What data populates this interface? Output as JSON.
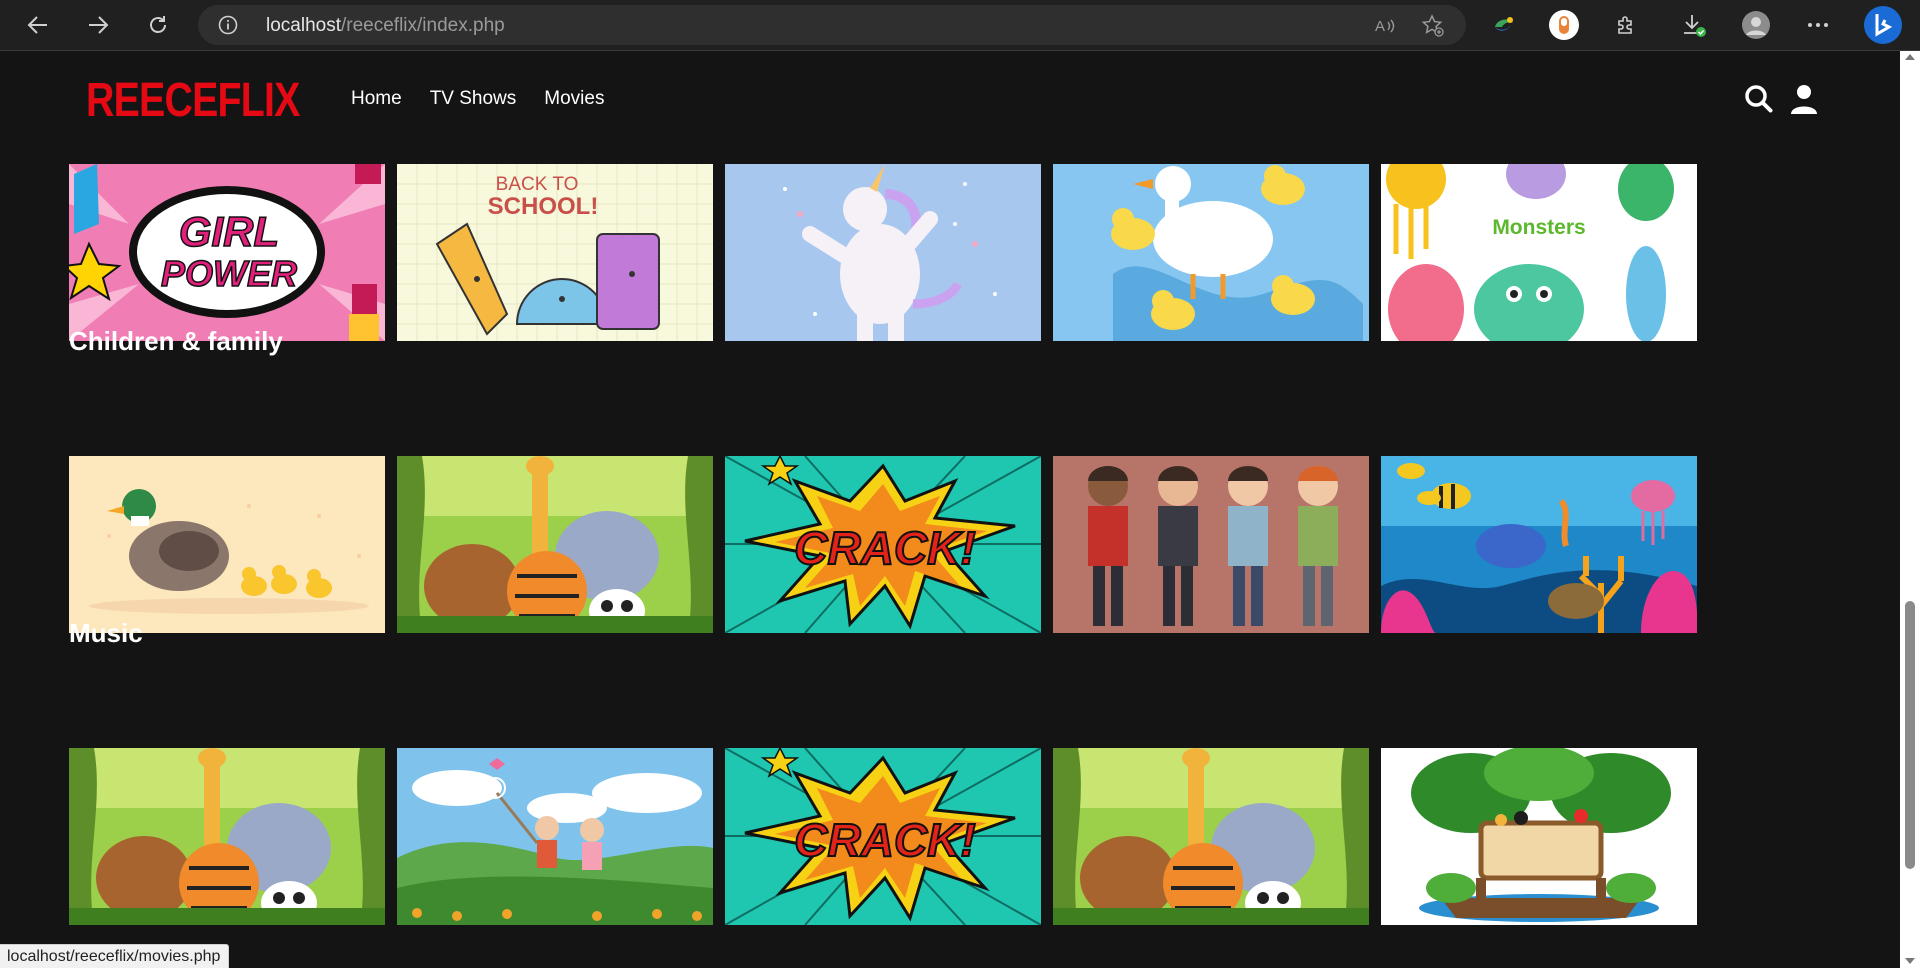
{
  "browser": {
    "url_host": "localhost",
    "url_path": "/reeceflix/index.php",
    "status_url": "localhost/reeceflix/movies.php"
  },
  "site": {
    "logo": "REECEFLIX",
    "nav": [
      "Home",
      "TV Shows",
      "Movies"
    ],
    "accent_color": "#e50914",
    "background_color": "#141414"
  },
  "rows": [
    {
      "title": "",
      "tiles": [
        "girl-power-comic",
        "back-to-school",
        "dabbing-unicorn",
        "goose-and-ducklings",
        "monsters"
      ]
    },
    {
      "title": "Children & family",
      "tiles": [
        "duck-family",
        "jungle-animals",
        "crack-comic",
        "boys-with-phones",
        "underwater-reef"
      ]
    },
    {
      "title": "Music",
      "tiles": [
        "jungle-animals",
        "kids-in-meadow",
        "crack-comic",
        "jungle-animals",
        "jungle-island-sign"
      ]
    }
  ],
  "artwork_text": {
    "girl_power_1": "GIRL",
    "girl_power_2": "POWER",
    "back_to_school_1": "BACK TO",
    "back_to_school_2": "SCHOOL!",
    "monsters": "Monsters",
    "crack": "CRACK!"
  }
}
